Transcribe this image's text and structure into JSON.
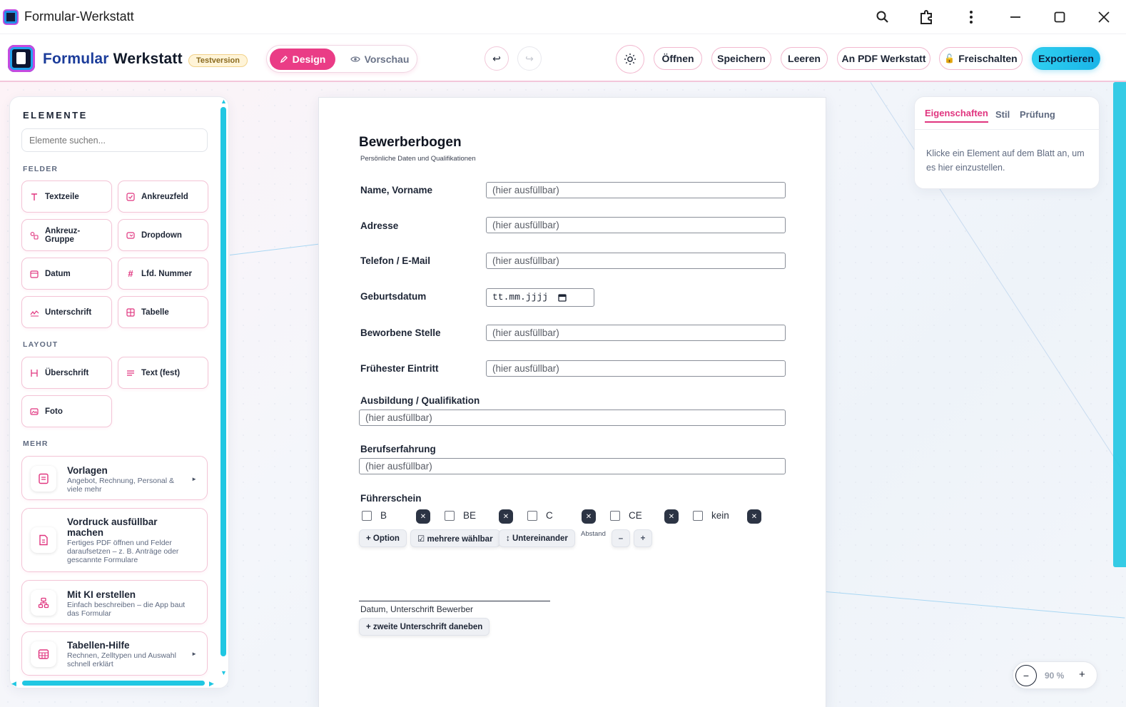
{
  "window": {
    "title": "Formular-Werkstatt"
  },
  "header": {
    "brand_part1": "Formular",
    "brand_part2": "Werkstatt",
    "badge": "Testversion",
    "mode_design": "Design",
    "mode_preview": "Vorschau",
    "undo": "↩",
    "redo": "↪",
    "buttons": {
      "open": "Öffnen",
      "save": "Speichern",
      "clear": "Leeren",
      "pdf": "An PDF Werkstatt",
      "unlock": "Freischalten",
      "export": "Exportieren"
    },
    "colors": {
      "accent": "#ea3c86",
      "export": "#22c1ea"
    }
  },
  "sidebar": {
    "title": "ELEMENTE",
    "search_placeholder": "Elemente suchen...",
    "section_fields": "FELDER",
    "section_layout": "LAYOUT",
    "section_more": "MEHR",
    "fields": [
      {
        "label": "Textzeile",
        "icon": "text-icon"
      },
      {
        "label": "Ankreuzfeld",
        "icon": "checkbox-icon"
      },
      {
        "label": "Ankreuz-Gruppe",
        "icon": "checkbox-group-icon"
      },
      {
        "label": "Dropdown",
        "icon": "dropdown-icon"
      },
      {
        "label": "Datum",
        "icon": "calendar-icon"
      },
      {
        "label": "Lfd. Nummer",
        "icon": "hash-icon"
      },
      {
        "label": "Unterschrift",
        "icon": "signature-icon"
      },
      {
        "label": "Tabelle",
        "icon": "table-icon"
      }
    ],
    "layout": [
      {
        "label": "Überschrift",
        "icon": "heading-icon"
      },
      {
        "label": "Text (fest)",
        "icon": "paragraph-icon"
      },
      {
        "label": "Foto",
        "icon": "image-icon"
      }
    ],
    "more": [
      {
        "title": "Vorlagen",
        "subtitle": "Angebot, Rechnung, Personal & viele mehr"
      },
      {
        "title": "Vordruck ausfüllbar machen",
        "subtitle": "Fertiges PDF öffnen und Felder daraufsetzen – z. B. Anträge oder gescannte Formulare"
      },
      {
        "title": "Mit KI erstellen",
        "subtitle": "Einfach beschreiben – die App baut das Formular"
      },
      {
        "title": "Tabellen-Hilfe",
        "subtitle": "Rechnen, Zelltypen und Auswahl schnell erklärt"
      }
    ]
  },
  "form": {
    "title": "Bewerberbogen",
    "subtitle": "Persönliche Daten und Qualifikationen",
    "placeholder": "(hier ausfüllbar)",
    "fields": {
      "name": "Name, Vorname",
      "address": "Adresse",
      "contact": "Telefon / E-Mail",
      "birthdate": "Geburtsdatum",
      "position": "Beworbene Stelle",
      "start": "Frühester Eintritt",
      "education": "Ausbildung / Qualifikation",
      "experience": "Berufserfahrung",
      "license": "Führerschein"
    },
    "date_placeholder": "tt.mm.jjjj",
    "license_options": [
      "B",
      "BE",
      "C",
      "CE",
      "kein"
    ],
    "option_tools": {
      "add": "+ Option",
      "multi": "☑ mehrere wählbar",
      "stacked": "↕ Untereinander",
      "spacing_label": "Abstand",
      "minus": "–",
      "plus": "+"
    },
    "signature_label": "Datum, Unterschrift Bewerber",
    "second_signature": "+ zweite Unterschrift daneben"
  },
  "properties": {
    "tabs": [
      "Eigenschaften",
      "Stil",
      "Prüfung"
    ],
    "hint": "Klicke ein Element auf dem Blatt an, um es hier einzustellen."
  },
  "zoom": {
    "value": "90 %",
    "minus": "−",
    "plus": "+"
  }
}
